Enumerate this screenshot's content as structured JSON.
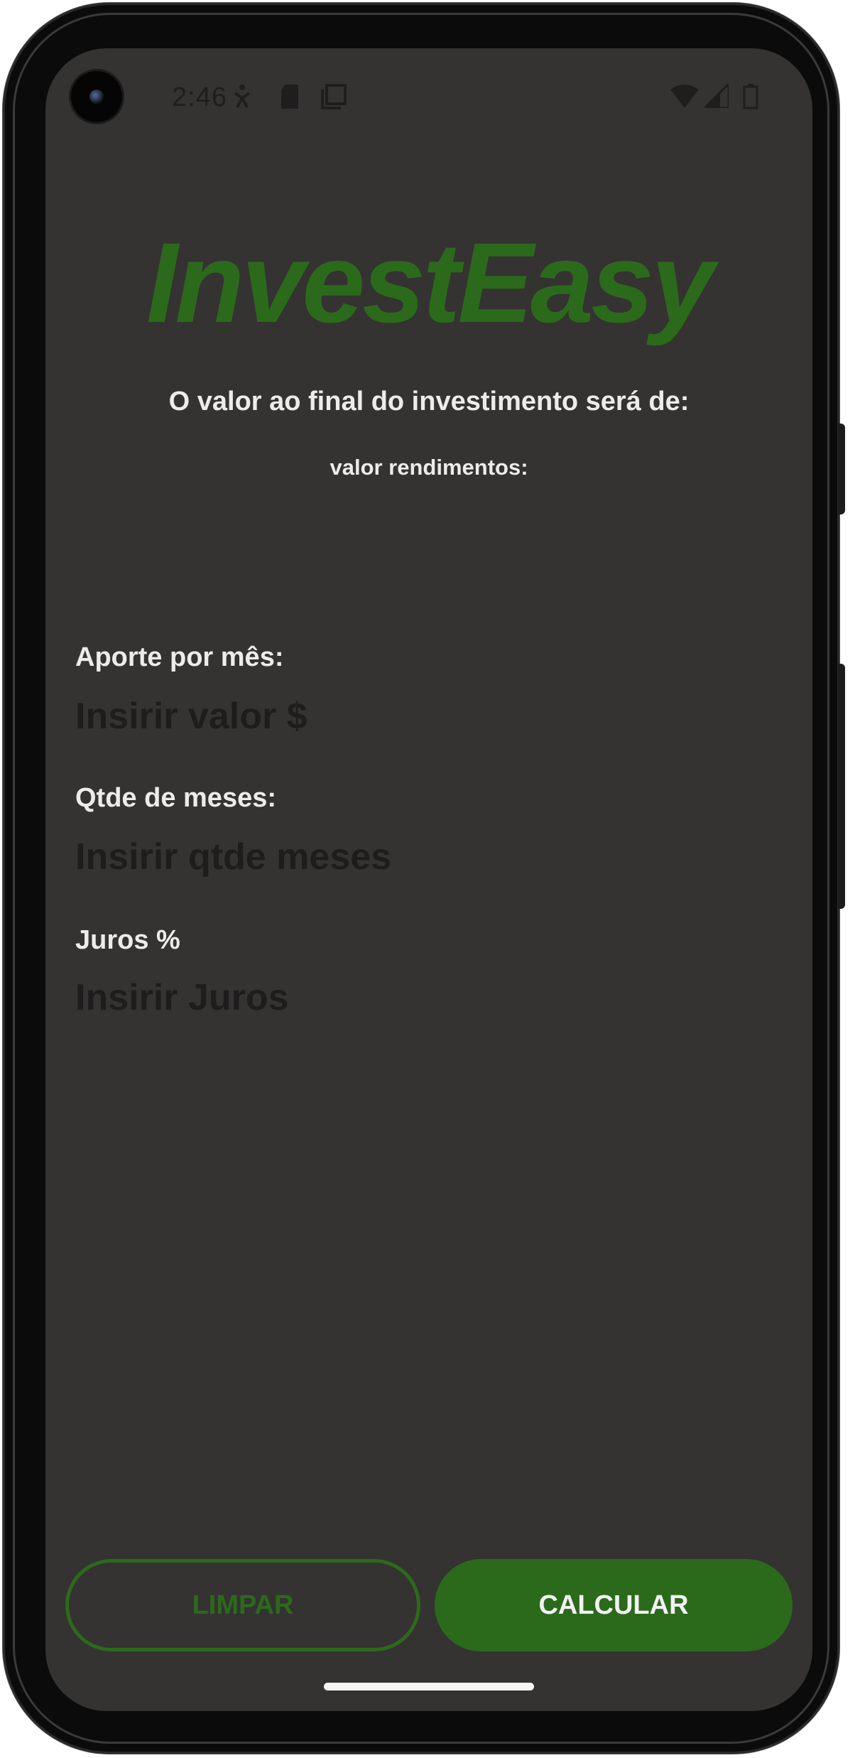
{
  "status_bar": {
    "time": "2:46",
    "icons": [
      "accessibility-icon",
      "sd-card-icon",
      "screenshot-icon",
      "wifi-icon",
      "cellular-signal-icon",
      "battery-icon"
    ]
  },
  "app": {
    "title": "InvestEasy",
    "result_label": "O valor ao final do investimento será de:",
    "yield_label": "valor rendimentos:"
  },
  "form": {
    "monthly_label": "Aporte por mês:",
    "monthly_placeholder": "Insirir valor $",
    "months_label": "Qtde de meses:",
    "months_placeholder": "Insirir qtde meses",
    "interest_label": "Juros %",
    "interest_placeholder": "Insirir Juros"
  },
  "actions": {
    "clear_label": "LIMPAR",
    "calculate_label": "CALCULAR"
  },
  "colors": {
    "background": "#353232",
    "accent": "#2b6a1b",
    "text": "#ececec",
    "placeholder": "#1e1c1c"
  }
}
